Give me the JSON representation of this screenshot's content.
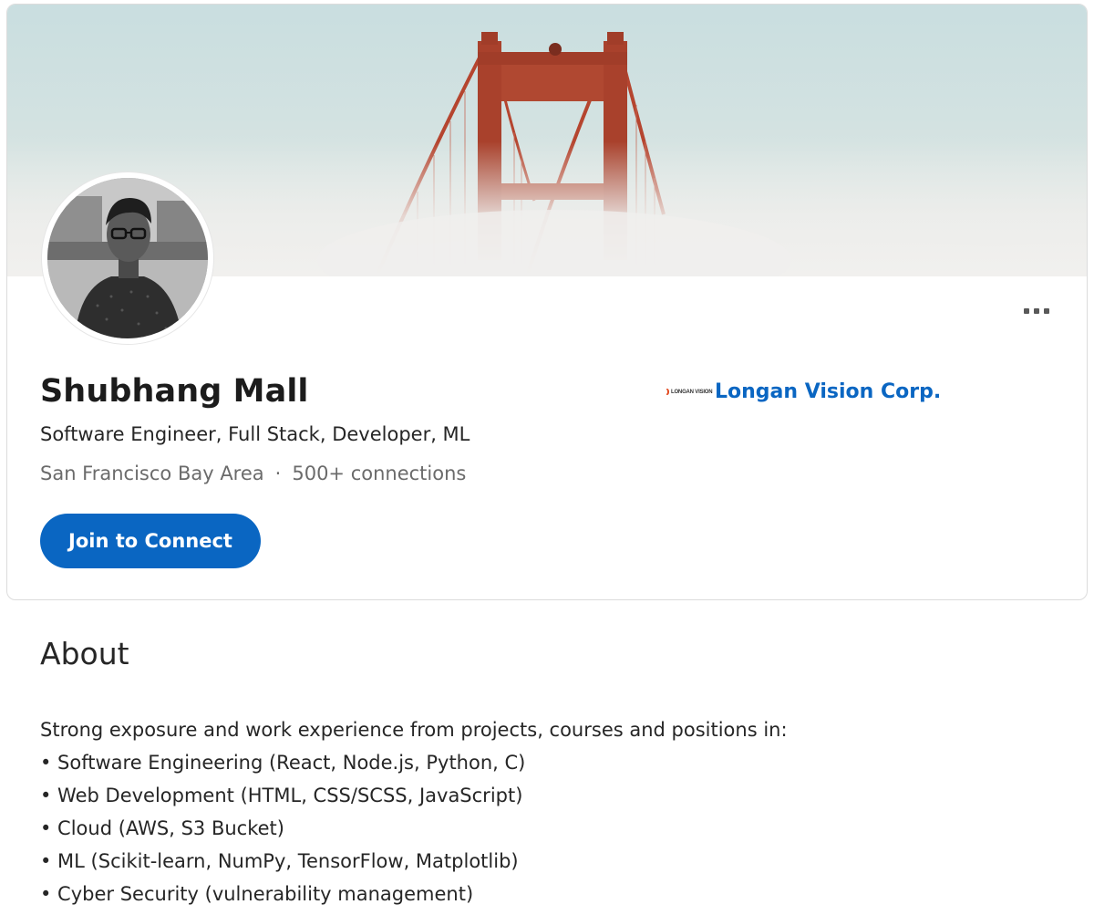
{
  "profile": {
    "name": "Shubhang Mall",
    "headline": "Software Engineer, Full Stack, Developer, ML",
    "location": "San Francisco Bay Area",
    "separator": "·",
    "connections": "500+ connections",
    "join_button_label": "Join to Connect",
    "more_icon": "more-horizontal-icon",
    "company": {
      "logo_text": "LONGAN VISION",
      "name": "Longan Vision Corp."
    }
  },
  "colors": {
    "accent": "#0a66c2",
    "bridge": "#b5452f"
  },
  "about": {
    "title": "About",
    "intro": "Strong exposure and work experience from projects, courses and positions in:",
    "items": [
      "• Software Engineering (React, Node.js, Python, C)",
      "• Web Development (HTML, CSS/SCSS, JavaScript)",
      "• Cloud (AWS, S3 Bucket)",
      "• ML (Scikit-learn, NumPy, TensorFlow, Matplotlib)",
      "• Cyber Security (vulnerability management)"
    ]
  }
}
